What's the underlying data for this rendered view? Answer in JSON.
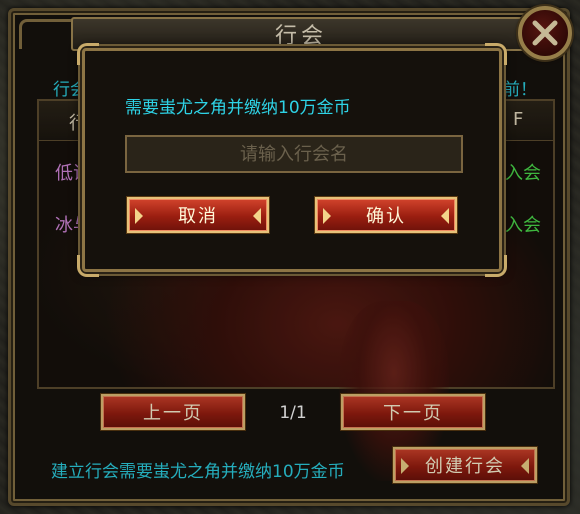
{
  "window": {
    "title": "行会"
  },
  "main": {
    "top_hint_left": "行会",
    "top_hint_right": "前！",
    "list_header_left": "行",
    "list_header_right": "F",
    "rows": [
      {
        "name": "低证",
        "join": "入会"
      },
      {
        "name": "冰与",
        "join": "入会"
      }
    ],
    "prev_page_label": "上一页",
    "page_indicator": "1/1",
    "next_page_label": "下一页",
    "create_hint": "建立行会需要蚩尤之角并缴纳10万金币",
    "create_guild_label": "创建行会"
  },
  "dialog": {
    "message": "需要蚩尤之角并缴纳10万金币",
    "input_value": "",
    "input_placeholder": "请输入行会名",
    "cancel_label": "取消",
    "confirm_label": "确认"
  },
  "colors": {
    "accent_cyan": "#2ed3e6",
    "button_red": "#9a1e10",
    "frame_gold": "#8d7545",
    "join_green": "#4de04d",
    "guild_name_purple": "#d88ae0"
  },
  "icons": {
    "close": "close-x-icon"
  }
}
